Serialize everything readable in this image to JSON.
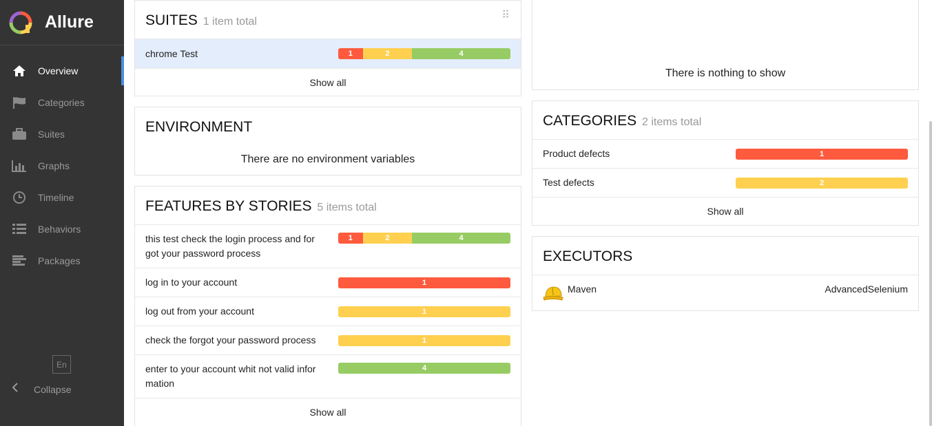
{
  "brand": {
    "name": "Allure"
  },
  "sidebar": {
    "items": [
      {
        "label": "Overview",
        "icon": "home-icon",
        "active": true
      },
      {
        "label": "Categories",
        "icon": "flag-icon",
        "active": false
      },
      {
        "label": "Suites",
        "icon": "briefcase-icon",
        "active": false
      },
      {
        "label": "Graphs",
        "icon": "bar-chart-icon",
        "active": false
      },
      {
        "label": "Timeline",
        "icon": "clock-icon",
        "active": false
      },
      {
        "label": "Behaviors",
        "icon": "list-icon",
        "active": false
      },
      {
        "label": "Packages",
        "icon": "align-left-icon",
        "active": false
      }
    ],
    "language": "En",
    "collapse_label": "Collapse"
  },
  "colors": {
    "failed": "#fd5a3e",
    "broken": "#ffd050",
    "passed": "#97cc64",
    "sidebar": "#343434",
    "accent": "#4a90e2"
  },
  "suites": {
    "title": "SUITES",
    "count": "1 item total",
    "rows": [
      {
        "name": "chrome Test",
        "failed": 1,
        "broken": 2,
        "passed": 4,
        "selected": true
      }
    ],
    "show_all": "Show all"
  },
  "environment": {
    "title": "ENVIRONMENT",
    "empty": "There are no environment variables"
  },
  "features": {
    "title": "FEATURES BY STORIES",
    "count": "5 items total",
    "rows": [
      {
        "name": "this test check the login process and for got your password process",
        "failed": 1,
        "broken": 2,
        "passed": 4
      },
      {
        "name": "log in to your account",
        "failed": 1,
        "broken": 0,
        "passed": 0
      },
      {
        "name": "log out from your account",
        "failed": 0,
        "broken": 1,
        "passed": 0
      },
      {
        "name": "check the forgot your password process",
        "failed": 0,
        "broken": 1,
        "passed": 0
      },
      {
        "name": "enter to your account whit not valid infor mation",
        "failed": 0,
        "broken": 0,
        "passed": 4
      }
    ],
    "show_all": "Show all"
  },
  "trend": {
    "empty": "There is nothing to show"
  },
  "categories": {
    "title": "CATEGORIES",
    "count": "2 items total",
    "rows": [
      {
        "name": "Product defects",
        "failed": 1,
        "broken": 0,
        "passed": 0
      },
      {
        "name": "Test defects",
        "failed": 0,
        "broken": 2,
        "passed": 0
      }
    ],
    "show_all": "Show all"
  },
  "executors": {
    "title": "EXECUTORS",
    "name": "Maven",
    "build": "AdvancedSelenium",
    "icon": "hard-hat-icon"
  }
}
